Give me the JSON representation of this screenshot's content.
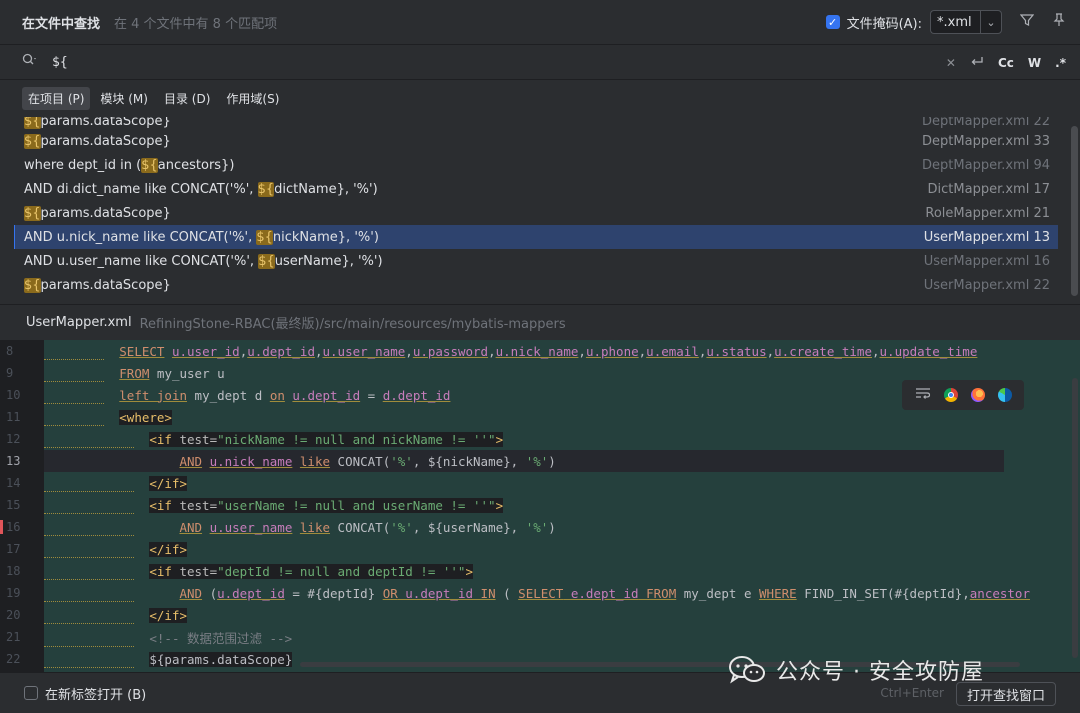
{
  "header": {
    "title": "在文件中查找",
    "subtitle": "在 4 个文件中有 8 个匹配项",
    "file_mask_label": "文件掩码(A):",
    "file_mask_value": "*.xml",
    "file_mask_checked": true
  },
  "search": {
    "query": "${",
    "options": [
      "Cc",
      "W",
      ".*"
    ]
  },
  "scopes": [
    {
      "label": "在项目 (P)",
      "active": true
    },
    {
      "label": "模块 (M)",
      "active": false
    },
    {
      "label": "目录 (D)",
      "active": false
    },
    {
      "label": "作用域(S)",
      "active": false
    }
  ],
  "results": [
    {
      "pre": "",
      "match": "${",
      "post": "params.dataScope}",
      "file": "DeptMapper.xml 22"
    },
    {
      "pre": "",
      "match": "${",
      "post": "params.dataScope}",
      "file": "DeptMapper.xml 33"
    },
    {
      "pre": "where dept_id in (",
      "match": "${",
      "post": "ancestors})",
      "file": "DeptMapper.xml 94"
    },
    {
      "pre": "AND di.dict_name like CONCAT('%', ",
      "match": "${",
      "post": "dictName}, '%')",
      "file": "DictMapper.xml 17"
    },
    {
      "pre": "",
      "match": "${",
      "post": "params.dataScope}",
      "file": "RoleMapper.xml 21"
    },
    {
      "pre": "AND u.nick_name like CONCAT('%', ",
      "match": "${",
      "post": "nickName}, '%')",
      "file": "UserMapper.xml 13"
    },
    {
      "pre": "AND u.user_name like CONCAT('%', ",
      "match": "${",
      "post": "userName}, '%')",
      "file": "UserMapper.xml 16"
    },
    {
      "pre": "",
      "match": "${",
      "post": "params.dataScope}",
      "file": "UserMapper.xml 22"
    }
  ],
  "preview": {
    "file_name": "UserMapper.xml",
    "file_path": "RefiningStone-RBAC(最终版)/src/main/resources/mybatis-mappers",
    "line_numbers": [
      "8",
      "9",
      "10",
      "11",
      "12",
      "13",
      "14",
      "15",
      "16",
      "17",
      "18",
      "19",
      "20",
      "21",
      "22"
    ],
    "current_line": "13"
  },
  "code": {
    "l8": [
      "SELECT",
      "u.user_id",
      "u.dept_id",
      "u.user_name",
      "u.password",
      "u.nick_name",
      "u.phone",
      "u.email",
      "u.status",
      "u.create_time",
      "u.update_time"
    ],
    "l9_kw": "FROM",
    "l9_rest": " my_user u",
    "l10_kw1": "left join",
    "l10_mid": " my_dept d ",
    "l10_kw2": "on",
    "l10_f1": "u.dept_id",
    "l10_eq": " = ",
    "l10_f2": "d.dept_id",
    "l11": "<where>",
    "l12_tag": "<if",
    "l12_attr": " test=",
    "l12_val": "\"nickName != null and nickName != ''\"",
    "l12_end": ">",
    "l13_kw1": "AND",
    "l13_f": "u.nick_name",
    "l13_kw2": "like",
    "l13_fn": " CONCAT(",
    "l13_s1": "'%'",
    "l13_p": ", ${nickName}, ",
    "l13_s2": "'%'",
    "l13_end": ")",
    "l14": "</if>",
    "l15_tag": "<if",
    "l15_attr": " test=",
    "l15_val": "\"userName != null and userName != ''\"",
    "l15_end": ">",
    "l16_kw1": "AND",
    "l16_f": "u.user_name",
    "l16_kw2": "like",
    "l16_fn": " CONCAT(",
    "l16_s1": "'%'",
    "l16_p": ", ${userName}, ",
    "l16_s2": "'%'",
    "l16_end": ")",
    "l17": "</if>",
    "l18_tag": "<if",
    "l18_attr": " test=",
    "l18_val": "\"deptId != null and deptId != ''\"",
    "l18_end": ">",
    "l19_kw1": "AND",
    "l19_a": " (",
    "l19_f1": "u.dept_id",
    "l19_b": " = #{deptId} ",
    "l19_kw2": "OR",
    "l19_f2": " u.dept_id",
    "l19_kw3": " IN",
    "l19_c": " ( ",
    "l19_kw4": "SELECT",
    "l19_f3": " e.dept_id",
    "l19_kw5": " FROM",
    "l19_d": " my_dept e ",
    "l19_kw6": "WHERE",
    "l19_e": " FIND_IN_SET(#{deptId},",
    "l19_f4": "ancestor",
    "l20": "</if>",
    "l21": "<!-- 数据范围过滤 -->",
    "l22": "${params.dataScope}"
  },
  "footer": {
    "new_tab_label": "在新标签打开 (B)",
    "shortcut": "Ctrl+Enter",
    "open_button": "打开查找窗口"
  },
  "watermark": "公众号 · 安全攻防屋",
  "colors": {
    "accent": "#3574f0",
    "selection": "#2e436e",
    "match_highlight": "#8a6a1c",
    "editor_bg": "#25403d"
  }
}
